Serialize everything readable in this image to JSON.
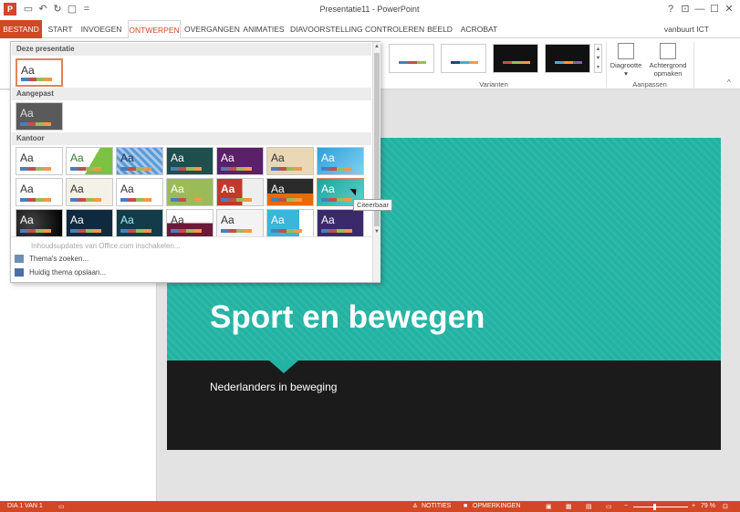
{
  "app": {
    "window_title": "Presentatie11 - PowerPoint",
    "user": "vanbuurt ICT",
    "icons": [
      "powerpoint-logo",
      "save-icon",
      "undo-icon",
      "redo-icon",
      "new-icon",
      "customize-qat-icon"
    ],
    "window_controls": {
      "help": "?",
      "restore": "⊡",
      "minimize": "—",
      "maximize": "☐",
      "close": "✕"
    }
  },
  "ribbon": {
    "tabs": [
      "BESTAND",
      "START",
      "INVOEGEN",
      "ONTWERPEN",
      "OVERGANGEN",
      "ANIMATIES",
      "DIAVOORSTELLING",
      "CONTROLEREN",
      "BEELD",
      "ACROBAT"
    ],
    "active_tab": "ONTWERPEN",
    "variants_group": "Varianten",
    "customize_group": "Aanpassen",
    "slide_size_label": "Diagrootte",
    "background_label_1": "Achtergrond",
    "background_label_2": "opmaken"
  },
  "gallery": {
    "section_this_presentation": "Deze presentatie",
    "section_custom": "Aangepast",
    "section_office": "Kantoor",
    "theme_text": "Aa",
    "tooltip": "Citeerbaar",
    "menu_update": "Inhoudsupdates van Office.com inschakelen...",
    "menu_search": "Thema's zoeken...",
    "menu_save": "Huidig thema opslaan..."
  },
  "slide": {
    "title": "Sport en bewegen",
    "subtitle": "Nederlanders in beweging"
  },
  "statusbar": {
    "slide_info": "DIA 1 VAN 1",
    "notes": "NOTITIES",
    "comments": "OPMERKINGEN",
    "zoom": "79 %"
  },
  "colors": {
    "accent": "#d24726",
    "slide_teal": "#23b3a3",
    "slide_dark": "#1b1b1b"
  }
}
